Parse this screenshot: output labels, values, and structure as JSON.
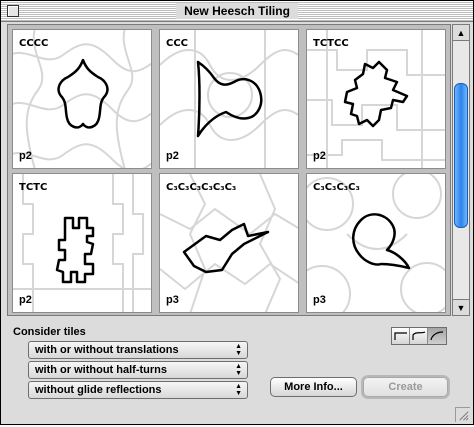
{
  "window": {
    "title": "New Heesch Tiling"
  },
  "tiles": [
    {
      "name": "CCCC",
      "symmetry": "p2"
    },
    {
      "name": "CCC",
      "symmetry": "p2"
    },
    {
      "name": "TCTCC",
      "symmetry": "p2"
    },
    {
      "name": "TCTC",
      "symmetry": "p2"
    },
    {
      "name": "C₃C₃C₃C₃C₃C₃",
      "symmetry": "p3"
    },
    {
      "name": "C₃C₃C₃C₃",
      "symmetry": "p3"
    }
  ],
  "options": {
    "label": "Consider tiles",
    "translations": "with or without translations",
    "half_turns": "with or without half-turns",
    "glide": "without glide reflections"
  },
  "buttons": {
    "more_info": "More Info...",
    "create": "Create"
  },
  "icons": {
    "close": "close-box-icon",
    "edge_types": [
      "straight-edge-icon",
      "s-curve-edge-icon",
      "arc-edge-icon"
    ],
    "scroll": [
      "scroll-up-arrow-icon",
      "scroll-down-arrow-icon"
    ],
    "resize": "resize-grip-icon"
  },
  "colors": {
    "scroll_thumb": "#2c83e8",
    "tile_background": "#ffffff",
    "outline": "#000000"
  }
}
